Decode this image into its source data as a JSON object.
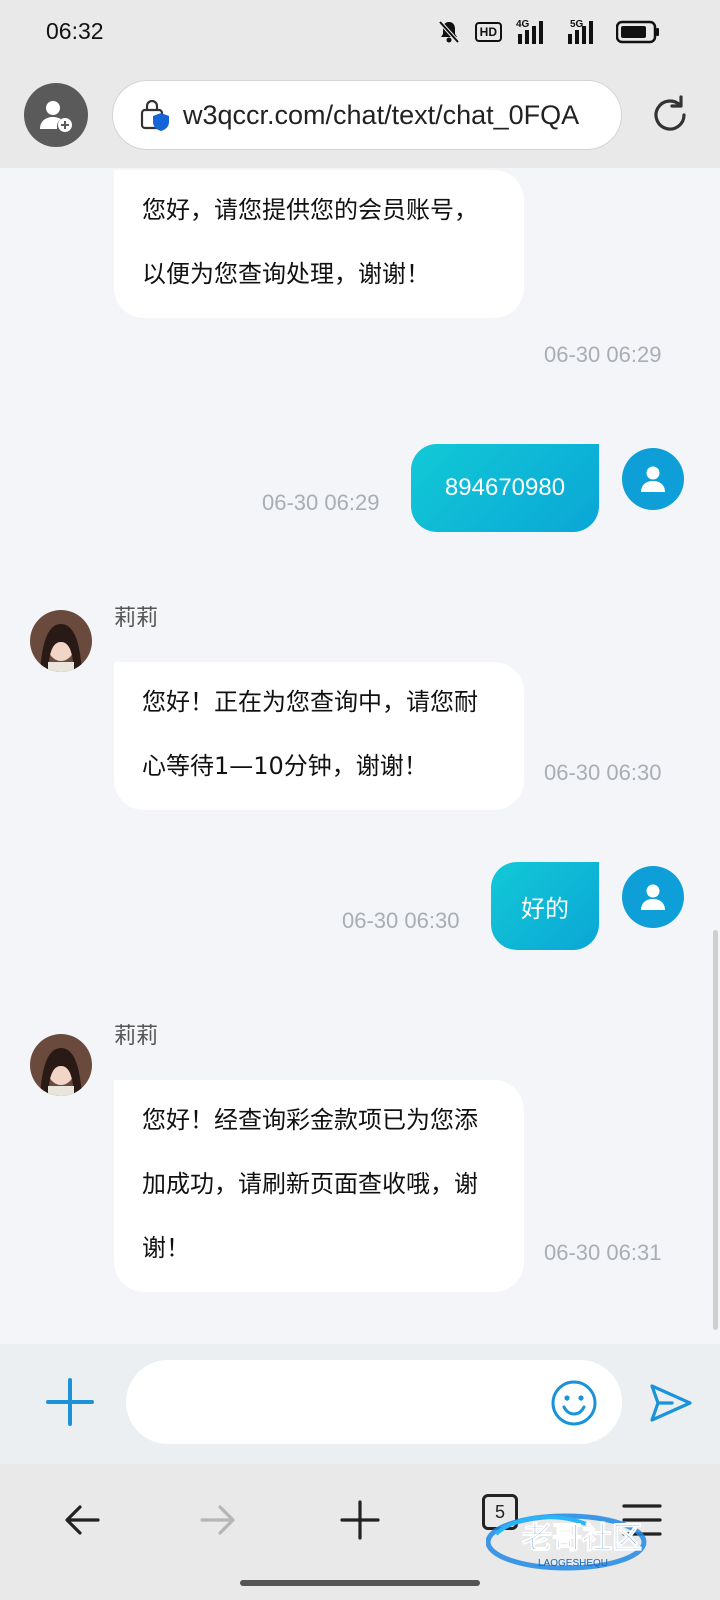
{
  "status_bar": {
    "time": "06:32",
    "hd_label": "HD",
    "network_4g": "4G",
    "network_5g": "5G",
    "icons": [
      "mute-icon",
      "hd-icon",
      "signal-4g-icon",
      "signal-5g-icon",
      "battery-icon"
    ]
  },
  "browser": {
    "url": "w3qccr.com/chat/text/chat_0FQA",
    "icons": [
      "profile-icon",
      "shield-lock-icon",
      "reload-icon"
    ]
  },
  "chat": {
    "messages": [
      {
        "direction": "in",
        "sender": "",
        "text": "您好，请您提供您的会员账号，以便为您查询处理，谢谢！",
        "time": "06-30 06:29"
      },
      {
        "direction": "out",
        "text": "894670980",
        "time": "06-30 06:29"
      },
      {
        "direction": "in",
        "sender": "莉莉",
        "text": "您好！正在为您查询中，请您耐心等待1—10分钟，谢谢！",
        "time": "06-30 06:30"
      },
      {
        "direction": "out",
        "text": "好的",
        "time": "06-30 06:30"
      },
      {
        "direction": "in",
        "sender": "莉莉",
        "text": "您好！经查询彩金款项已为您添加成功，请刷新页面查收哦，谢谢！",
        "time": "06-30 06:31"
      }
    ]
  },
  "composer": {
    "placeholder": "",
    "icons": [
      "plus-icon",
      "emoji-icon",
      "send-icon"
    ]
  },
  "bottom_nav": {
    "tab_count": "5",
    "watermark_text": "老哥社区",
    "watermark_subtext": "LAOGESHEQU",
    "icons": [
      "back-arrow-icon",
      "forward-arrow-icon",
      "new-tab-icon",
      "tabs-icon",
      "menu-icon"
    ]
  },
  "colors": {
    "accent": "#0f9fd8",
    "bubble_out_start": "#12c9d6",
    "bubble_out_end": "#0aa6d6",
    "timestamp": "#a9aeb5"
  }
}
